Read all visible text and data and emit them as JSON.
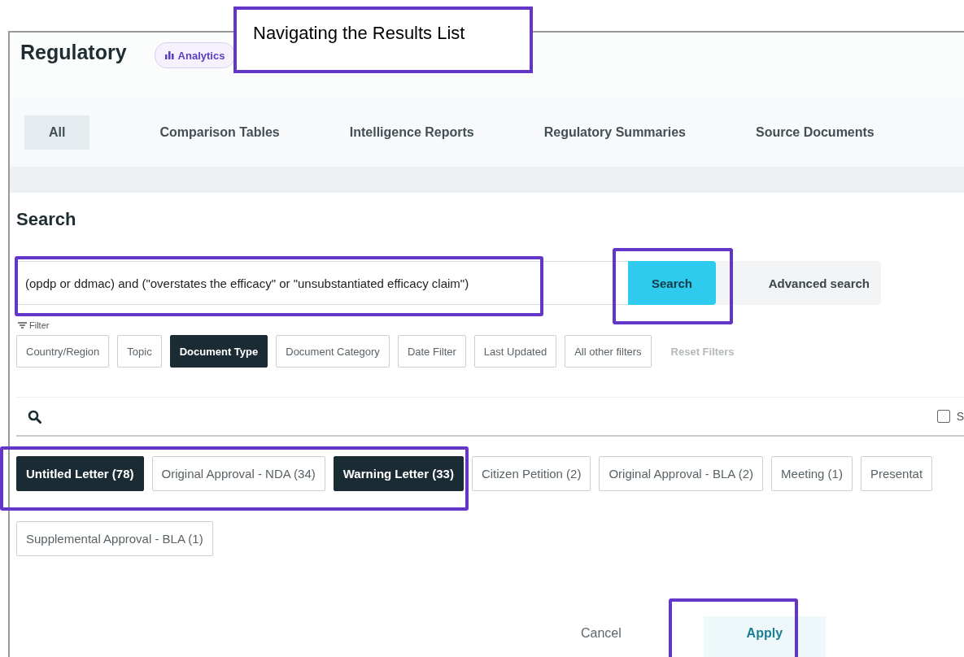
{
  "callout": {
    "text": "Navigating the Results List"
  },
  "header": {
    "title": "Regulatory",
    "badge": "Analytics"
  },
  "tabs": [
    {
      "label": "All",
      "selected": true
    },
    {
      "label": "Comparison Tables",
      "selected": false
    },
    {
      "label": "Intelligence Reports",
      "selected": false
    },
    {
      "label": "Regulatory Summaries",
      "selected": false
    },
    {
      "label": "Source Documents",
      "selected": false
    }
  ],
  "search": {
    "heading": "Search",
    "value": "(opdp or ddmac) and (\"overstates the efficacy\" or \"unsubstantiated efficacy claim\")",
    "button": "Search",
    "advanced": "Advanced search"
  },
  "filter": {
    "label": "Filter",
    "chips": [
      {
        "label": "Country/Region",
        "selected": false
      },
      {
        "label": "Topic",
        "selected": false
      },
      {
        "label": "Document Type",
        "selected": true
      },
      {
        "label": "Document Category",
        "selected": false
      },
      {
        "label": "Date Filter",
        "selected": false
      },
      {
        "label": "Last Updated",
        "selected": false
      },
      {
        "label": "All other filters",
        "selected": false
      }
    ],
    "reset": "Reset Filters"
  },
  "select_all": {
    "label": "S",
    "checked": false
  },
  "document_types": [
    [
      {
        "label": "Untitled Letter (78)",
        "selected": true
      },
      {
        "label": "Original Approval - NDA (34)",
        "selected": false
      },
      {
        "label": "Warning Letter (33)",
        "selected": true
      },
      {
        "label": "Citizen Petition (2)",
        "selected": false
      },
      {
        "label": "Original Approval - BLA (2)",
        "selected": false
      },
      {
        "label": "Meeting (1)",
        "selected": false
      },
      {
        "label": "Presentat",
        "selected": false
      }
    ],
    [
      {
        "label": "Supplemental Approval - BLA (1)",
        "selected": false
      }
    ]
  ],
  "actions": {
    "cancel": "Cancel",
    "apply": "Apply"
  }
}
